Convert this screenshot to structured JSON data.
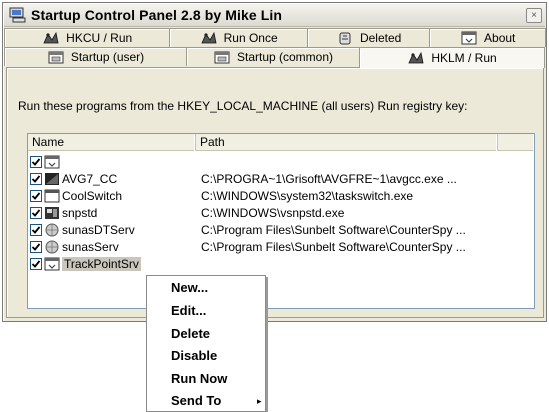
{
  "window": {
    "title": "Startup Control Panel 2.8 by Mike Lin",
    "close_glyph": "×"
  },
  "tabs_row1": [
    {
      "label": "HKCU / Run",
      "icon": "registry-icon"
    },
    {
      "label": "Run Once",
      "icon": "registry-icon"
    },
    {
      "label": "Deleted",
      "icon": "recycle-icon"
    },
    {
      "label": "About",
      "icon": "window-icon"
    }
  ],
  "tabs_row2": [
    {
      "label": "Startup (user)",
      "icon": "folder-icon"
    },
    {
      "label": "Startup (common)",
      "icon": "folder-icon"
    },
    {
      "label": "HKLM / Run",
      "icon": "registry-icon",
      "active": true
    }
  ],
  "panel": {
    "description": "Run these programs from the HKEY_LOCAL_MACHINE (all users) Run registry key:"
  },
  "list": {
    "columns": [
      "Name",
      "Path"
    ],
    "rows": [
      {
        "name": "",
        "path": "",
        "checked": true,
        "icon": "window-icon"
      },
      {
        "name": "AVG7_CC",
        "path": "C:\\PROGRA~1\\Grisoft\\AVGFRE~1\\avgcc.exe ...",
        "checked": true,
        "icon": "avg-icon"
      },
      {
        "name": "CoolSwitch",
        "path": "C:\\WINDOWS\\system32\\taskswitch.exe",
        "checked": true,
        "icon": "window-icon"
      },
      {
        "name": "snpstd",
        "path": "C:\\WINDOWS\\vsnpstd.exe",
        "checked": true,
        "icon": "camera-icon"
      },
      {
        "name": "sunasDTServ",
        "path": "C:\\Program Files\\Sunbelt Software\\CounterSpy ...",
        "checked": true,
        "icon": "globe-icon"
      },
      {
        "name": "sunasServ",
        "path": "C:\\Program Files\\Sunbelt Software\\CounterSpy ...",
        "checked": true,
        "icon": "globe-icon"
      },
      {
        "name": "TrackPointSrv",
        "path": "",
        "checked": true,
        "icon": "window-icon",
        "selected": true
      }
    ]
  },
  "context_menu": {
    "items": [
      "New...",
      "Edit...",
      "Delete",
      "Disable",
      "Run Now",
      "Send To"
    ],
    "submenu_glyph": "▸"
  },
  "colors": {
    "window_bg": "#ece9d8",
    "list_border": "#7f9db9",
    "checkbox_border": "#1c5180",
    "selection": "#c9c7bb"
  }
}
